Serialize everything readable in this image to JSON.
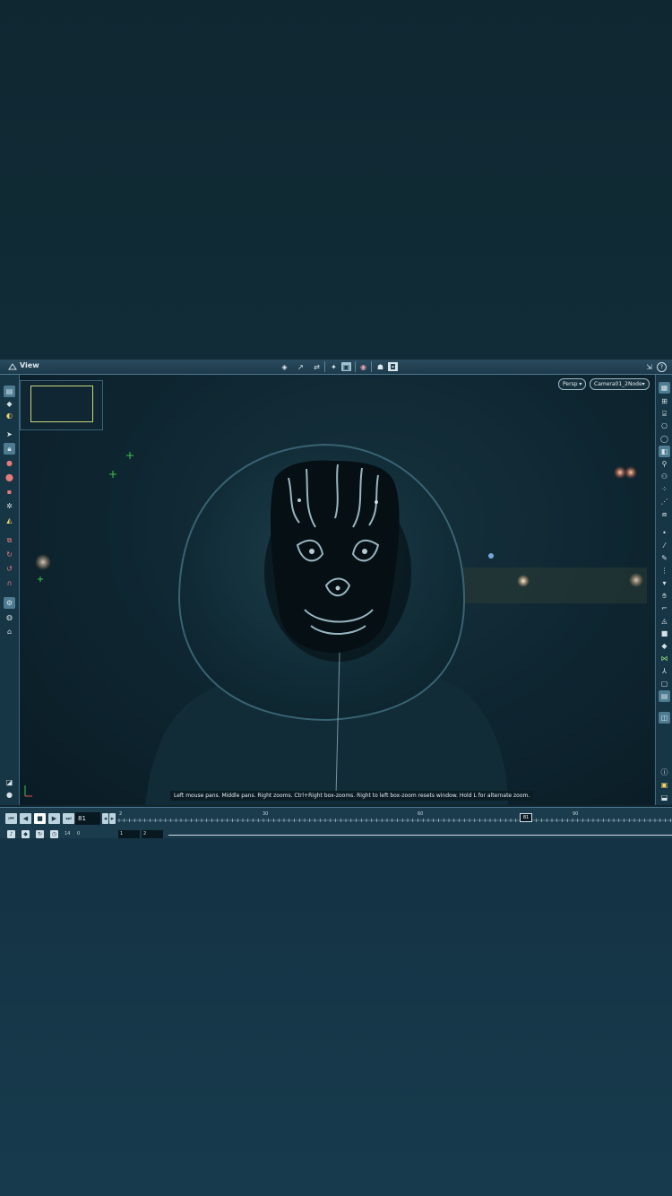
{
  "titlebar": {
    "title": "View",
    "icons": [
      "view-select-icon",
      "view-orbit-icon",
      "view-pan-icon",
      "view-object-icon",
      "view-shaded-icon",
      "view-wire-icon",
      "view-render-icon",
      "view-camera-icon"
    ],
    "right_icons": [
      "link-icon",
      "help-icon"
    ],
    "help": "?"
  },
  "viewport": {
    "persp_label": "Persp ▾",
    "camera_label": "Camera01_2Node▾"
  },
  "hint_text": "Left mouse pans. Middle pans. Right zooms. Ctrl+Right box-zooms. Right to left box-zoom resets window. Hold L for alternate zoom.",
  "playback": {
    "current_frame": "81",
    "ticks": [
      "2",
      "30",
      "60",
      "90"
    ],
    "marker_frame": "81",
    "range_start": "1",
    "range_end": "2",
    "range_small_labels": [
      "14",
      "0"
    ]
  },
  "colors": {
    "accent": "#9fc3d3",
    "guide_green": "#3ec24a",
    "minimap_frame": "#c9d47a"
  }
}
